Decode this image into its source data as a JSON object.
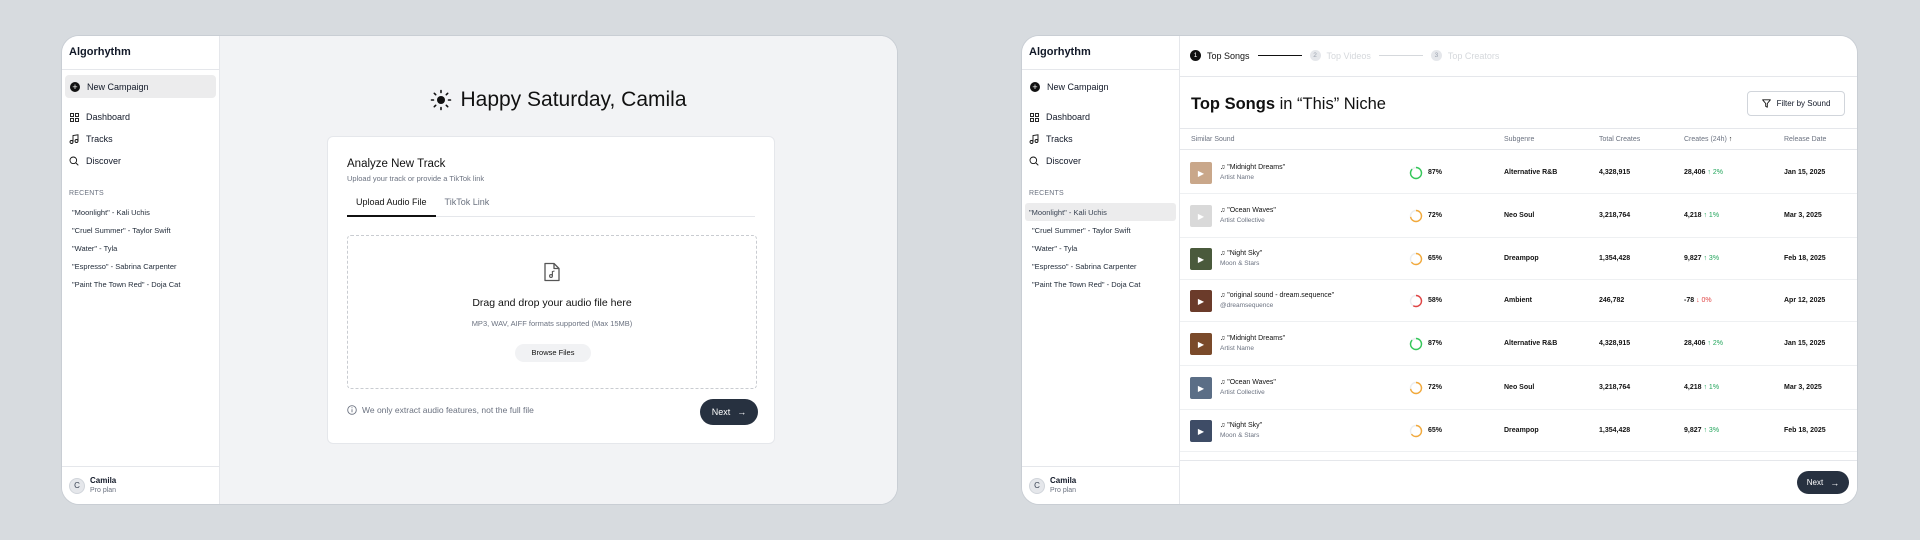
{
  "left": {
    "brand": "Algorhythm",
    "new_campaign": "New Campaign",
    "nav": [
      {
        "label": "Dashboard",
        "icon": "grid-icon"
      },
      {
        "label": "Tracks",
        "icon": "music-note-icon"
      },
      {
        "label": "Discover",
        "icon": "search-icon"
      }
    ],
    "recents_header": "RECENTS",
    "recents": [
      "\"Moonlight\" - Kali Uchis",
      "\"Cruel Summer\" - Taylor Swift",
      "\"Water\" - Tyla",
      "\"Espresso\" - Sabrina Carpenter",
      "\"Paint The Town Red\" - Doja Cat"
    ],
    "user": {
      "initial": "C",
      "name": "Camila",
      "plan": "Pro plan"
    },
    "greeting": "Happy Saturday, Camila",
    "card": {
      "title": "Analyze New Track",
      "subtitle": "Upload your track or provide a TikTok link",
      "tabs": [
        "Upload Audio File",
        "TikTok Link"
      ],
      "active_tab": 0,
      "drop_title": "Drag and drop your audio file here",
      "drop_sub": "MP3, WAV, AIFF formats supported (Max 15MB)",
      "browse": "Browse Files",
      "note": "We only extract audio features, not the full file",
      "next": "Next"
    }
  },
  "right": {
    "brand": "Algorhythm",
    "new_campaign": "New Campaign",
    "nav": [
      {
        "label": "Dashboard",
        "icon": "grid-icon"
      },
      {
        "label": "Tracks",
        "icon": "music-note-icon"
      },
      {
        "label": "Discover",
        "icon": "search-icon"
      }
    ],
    "recents_header": "RECENTS",
    "recents": [
      "\"Moonlight\" - Kali Uchis",
      "\"Cruel Summer\" - Taylor Swift",
      "\"Water\" - Tyla",
      "\"Espresso\" - Sabrina Carpenter",
      "\"Paint The Town Red\" - Doja Cat"
    ],
    "active_recent": 0,
    "user": {
      "initial": "C",
      "name": "Camila",
      "plan": "Pro plan"
    },
    "steps": [
      {
        "num": "1",
        "label": "Top Songs",
        "active": true
      },
      {
        "num": "2",
        "label": "Top Videos",
        "active": false
      },
      {
        "num": "3",
        "label": "Top Creators",
        "active": false
      }
    ],
    "title_bold": "Top Songs",
    "title_rest": " in “This” Niche",
    "filter_button": "Filter by Sound",
    "columns": {
      "sound": "Similar Sound",
      "subgenre": "Subgenre",
      "total": "Total Creates",
      "creates": "Creates (24h)",
      "date": "Release Date"
    },
    "rows": [
      {
        "name": "\"Midnight Dreams\"",
        "artist": "Artist Name",
        "pct": "87%",
        "pct_value": 87,
        "ring_color": "#34c759",
        "subgenre": "Alternative R&B",
        "total": "4,328,915",
        "creates": "28,406",
        "change": "↑ 2%",
        "dir": "up",
        "date": "Jan 15, 2025",
        "thumb_color": "#c9a78a"
      },
      {
        "name": "\"Ocean Waves\"",
        "artist": "Artist Collective",
        "pct": "72%",
        "pct_value": 72,
        "ring_color": "#f2a93b",
        "subgenre": "Neo Soul",
        "total": "3,218,764",
        "creates": "4,218",
        "change": "↑ 1%",
        "dir": "up",
        "date": "Mar 3, 2025",
        "thumb_color": "#d9d9d9"
      },
      {
        "name": "\"Night Sky\"",
        "artist": "Moon & Stars",
        "pct": "65%",
        "pct_value": 65,
        "ring_color": "#f2a93b",
        "subgenre": "Dreampop",
        "total": "1,354,428",
        "creates": "9,827",
        "change": "↑ 3%",
        "dir": "up",
        "date": "Feb 18, 2025",
        "thumb_color": "#4a5a3c"
      },
      {
        "name": "\"original sound - dream.sequence\"",
        "artist": "@dreamsequence",
        "pct": "58%",
        "pct_value": 58,
        "ring_color": "#e04444",
        "subgenre": "Ambient",
        "total": "246,782",
        "creates": "-78",
        "change": "↓ 0%",
        "dir": "down",
        "date": "Apr 12, 2025",
        "thumb_color": "#6b3b2a"
      },
      {
        "name": "\"Midnight Dreams\"",
        "artist": "Artist Name",
        "pct": "87%",
        "pct_value": 87,
        "ring_color": "#34c759",
        "subgenre": "Alternative R&B",
        "total": "4,328,915",
        "creates": "28,406",
        "change": "↑ 2%",
        "dir": "up",
        "date": "Jan 15, 2025",
        "thumb_color": "#7a4a2a"
      },
      {
        "name": "\"Ocean Waves\"",
        "artist": "Artist Collective",
        "pct": "72%",
        "pct_value": 72,
        "ring_color": "#f2a93b",
        "subgenre": "Neo Soul",
        "total": "3,218,764",
        "creates": "4,218",
        "change": "↑ 1%",
        "dir": "up",
        "date": "Mar 3, 2025",
        "thumb_color": "#5b6e86"
      },
      {
        "name": "\"Night Sky\"",
        "artist": "Moon & Stars",
        "pct": "65%",
        "pct_value": 65,
        "ring_color": "#f2a93b",
        "subgenre": "Dreampop",
        "total": "1,354,428",
        "creates": "9,827",
        "change": "↑ 3%",
        "dir": "up",
        "date": "Feb 18, 2025",
        "thumb_color": "#3e4c66"
      }
    ],
    "next": "Next"
  }
}
